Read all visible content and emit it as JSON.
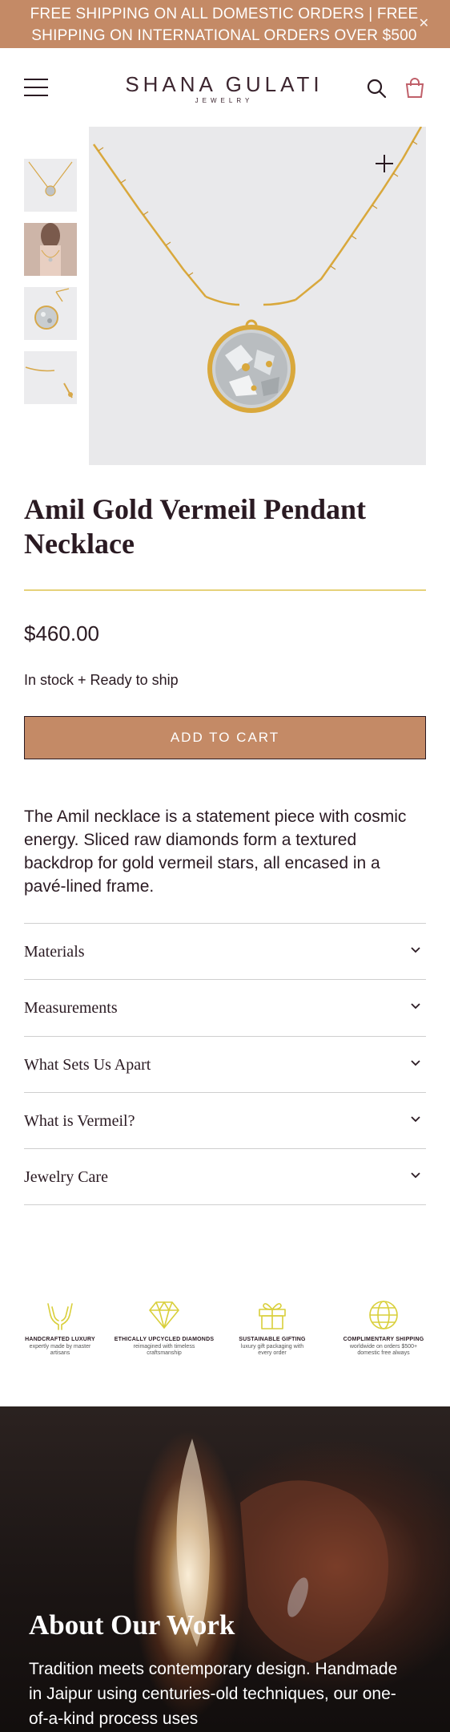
{
  "announcement": {
    "text": "FREE SHIPPING ON ALL DOMESTIC ORDERS | FREE SHIPPING ON INTERNATIONAL ORDERS OVER $500",
    "close_icon": "close-icon"
  },
  "header": {
    "brand_name": "SHANA GULATI",
    "brand_sub": "JEWELRY",
    "icons": [
      "menu-icon",
      "search-icon",
      "bag-icon"
    ]
  },
  "gallery": {
    "thumbnails": [
      "necklace-front",
      "model-wearing",
      "pendant-closeup",
      "chain-detail"
    ],
    "zoom_icon": "plus-icon"
  },
  "product": {
    "title": "Amil Gold Vermeil Pendant Necklace",
    "price": "$460.00",
    "stock": "In stock + Ready to ship",
    "add_to_cart": "ADD TO CART",
    "description": "The Amil necklace is a statement piece with cosmic energy. Sliced raw diamonds form a textured backdrop for gold vermeil stars, all encased in a pavé-lined frame."
  },
  "accordion": [
    {
      "label": "Materials"
    },
    {
      "label": "Measurements"
    },
    {
      "label": "What Sets Us Apart"
    },
    {
      "label": "What is Vermeil?"
    },
    {
      "label": "Jewelry Care"
    }
  ],
  "features": [
    {
      "icon": "hands-icon",
      "title": "HANDCRAFTED LUXURY",
      "subtitle": "expertly made by master artisans"
    },
    {
      "icon": "diamond-icon",
      "title": "ETHICALLY UPCYCLED DIAMONDS",
      "subtitle": "reimagined with timeless craftsmanship"
    },
    {
      "icon": "gift-icon",
      "title": "SUSTAINABLE GIFTING",
      "subtitle": "luxury gift packaging with every order"
    },
    {
      "icon": "globe-icon",
      "title": "COMPLIMENTARY SHIPPING",
      "subtitle": "worldwide on orders $500+ domestic free always"
    }
  ],
  "about": {
    "title": "About Our Work",
    "text": "Tradition meets contemporary design. Handmade in Jaipur using centuries-old techniques, our one-of-a-kind process uses"
  },
  "colors": {
    "accent": "#c48a66",
    "text": "#2a1a22",
    "gold_rule": "#e6d27a",
    "feature_icon": "#d9cf3a"
  }
}
